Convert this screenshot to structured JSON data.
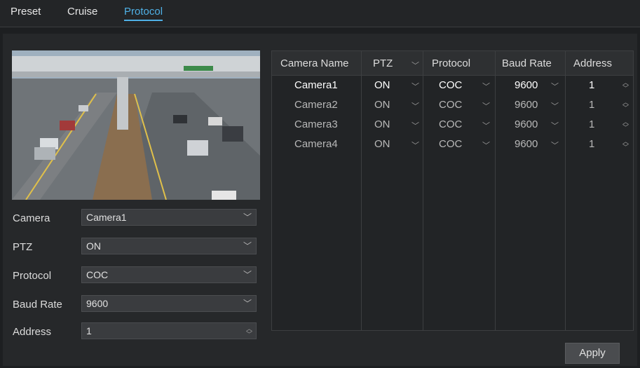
{
  "tabs": [
    {
      "label": "Preset"
    },
    {
      "label": "Cruise"
    },
    {
      "label": "Protocol",
      "active": true
    }
  ],
  "form": {
    "camera": {
      "label": "Camera",
      "value": "Camera1"
    },
    "ptz": {
      "label": "PTZ",
      "value": "ON"
    },
    "protocol": {
      "label": "Protocol",
      "value": "COC"
    },
    "baud_rate": {
      "label": "Baud Rate",
      "value": "9600"
    },
    "address": {
      "label": "Address",
      "value": "1"
    }
  },
  "table": {
    "headers": [
      "Camera Name",
      "PTZ",
      "Protocol",
      "Baud Rate",
      "Address"
    ],
    "rows": [
      {
        "camera": "Camera1",
        "ptz": "ON",
        "protocol": "COC",
        "baud": "9600",
        "address": "1"
      },
      {
        "camera": "Camera2",
        "ptz": "ON",
        "protocol": "COC",
        "baud": "9600",
        "address": "1"
      },
      {
        "camera": "Camera3",
        "ptz": "ON",
        "protocol": "COC",
        "baud": "9600",
        "address": "1"
      },
      {
        "camera": "Camera4",
        "ptz": "ON",
        "protocol": "COC",
        "baud": "9600",
        "address": "1"
      }
    ]
  },
  "apply_label": "Apply",
  "colors": {
    "accent": "#4fb1e6",
    "background": "#1d1f21"
  }
}
